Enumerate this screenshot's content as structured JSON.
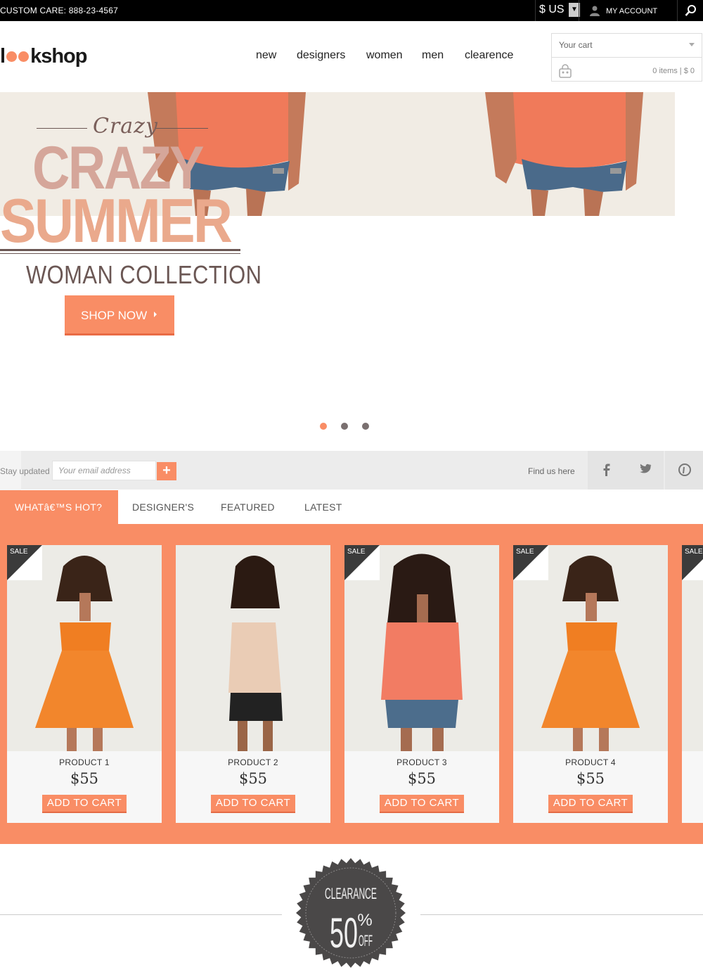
{
  "topbar": {
    "custom_care": "CUSTOM CARE: 888-23-4567",
    "currency": "$ US",
    "my_account": "MY ACCOUNT"
  },
  "logo": {
    "prefix": "l",
    "suffix": "kshop"
  },
  "nav": [
    "new",
    "designers",
    "women",
    "men",
    "clearence"
  ],
  "cart": {
    "title": "Your cart",
    "summary": "0 items | $ 0"
  },
  "hero": {
    "script": "Crazy",
    "line1": "CRAZY",
    "line2": "SUMMER",
    "subtitle": "WOMAN COLLECTION",
    "button": "SHOP NOW",
    "slide_count": 3,
    "active_slide": 1
  },
  "newsletter": {
    "label": "Stay updated",
    "placeholder": "Your email address",
    "find_us": "Find us here",
    "social": [
      "facebook-icon",
      "twitter-icon",
      "pinterest-icon"
    ]
  },
  "tabs": [
    "WHATâ€™S HOT?",
    "DESIGNER'S",
    "FEATURED",
    "LATEST"
  ],
  "products": [
    {
      "name": "PRODUCT 1",
      "price": "$55",
      "sale": "SALE",
      "button": "ADD TO CART",
      "garment": "orange-dress"
    },
    {
      "name": "PRODUCT 2",
      "price": "$55",
      "sale": "",
      "button": "ADD TO CART",
      "garment": "sequin-top"
    },
    {
      "name": "PRODUCT 3",
      "price": "$55",
      "sale": "SALE",
      "button": "ADD TO CART",
      "garment": "coral-tee"
    },
    {
      "name": "PRODUCT 4",
      "price": "$55",
      "sale": "SALE",
      "button": "ADD TO CART",
      "garment": "orange-dress"
    },
    {
      "name": "",
      "price": "",
      "sale": "SALE",
      "button": "",
      "garment": "partial"
    }
  ],
  "clearance": {
    "word": "CLEARANCE",
    "number": "50",
    "percent": "%",
    "off": "OFF"
  },
  "colors": {
    "accent": "#f98d65",
    "dark": "#3b3b3b",
    "brown": "#6b5754"
  }
}
